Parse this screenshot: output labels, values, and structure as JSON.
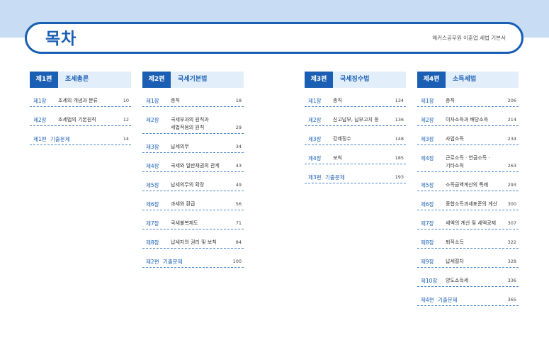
{
  "header": {
    "title": "목차",
    "subtitle": "해커스공무원 이훈업 세법 기본서"
  },
  "columns": [
    {
      "part_num": "제1편",
      "part_title": "조세총론",
      "entries": [
        {
          "num": "제1장",
          "title": "조세의 개념과 분류",
          "page": "10"
        },
        {
          "num": "제2장",
          "title": "조세법의 기본원칙",
          "page": "12"
        },
        {
          "num": "제1편",
          "title": "기출문제",
          "page": "14",
          "review": true
        }
      ]
    },
    {
      "part_num": "제2편",
      "part_title": "국세기본법",
      "entries": [
        {
          "num": "제1장",
          "title": "총칙",
          "page": "18"
        },
        {
          "num": "제2장",
          "title": "국세부과의 원칙과\n세법적용의 원칙",
          "page": "29"
        },
        {
          "num": "제3장",
          "title": "납세의무",
          "page": "34"
        },
        {
          "num": "제4장",
          "title": "국세와 일반채권의 관계",
          "page": "43"
        },
        {
          "num": "제5장",
          "title": "납세의무의 확장",
          "page": "49"
        },
        {
          "num": "제6장",
          "title": "과세와 환급",
          "page": "56"
        },
        {
          "num": "제7장",
          "title": "국세불복제도",
          "page": "71"
        },
        {
          "num": "제8장",
          "title": "납세자의 권리 및 보칙",
          "page": "84"
        },
        {
          "num": "제2편",
          "title": "기출문제",
          "page": "100",
          "review": true
        }
      ]
    },
    {
      "part_num": "제3편",
      "part_title": "국세징수법",
      "entries": [
        {
          "num": "제1장",
          "title": "총칙",
          "page": "134"
        },
        {
          "num": "제2장",
          "title": "신고납부, 납부고지 등",
          "page": "136"
        },
        {
          "num": "제3장",
          "title": "강제징수",
          "page": "148"
        },
        {
          "num": "제4장",
          "title": "보칙",
          "page": "185"
        },
        {
          "num": "제3편",
          "title": "기출문제",
          "page": "193",
          "review": true
        }
      ]
    },
    {
      "part_num": "제4편",
      "part_title": "소득세법",
      "entries": [
        {
          "num": "제1장",
          "title": "총칙",
          "page": "206"
        },
        {
          "num": "제2장",
          "title": "이자소득과 배당소득",
          "page": "214"
        },
        {
          "num": "제3장",
          "title": "사업소득",
          "page": "234"
        },
        {
          "num": "제4장",
          "title": "근로소득 · 연금소득 ·\n기타소득",
          "page": "263"
        },
        {
          "num": "제5장",
          "title": "소득금액계산의 특례",
          "page": "293"
        },
        {
          "num": "제6장",
          "title": "종합소득과세표준의 계산",
          "page": "300"
        },
        {
          "num": "제7장",
          "title": "세액의 계산 및 세액공제",
          "page": "307"
        },
        {
          "num": "제8장",
          "title": "퇴직소득",
          "page": "322"
        },
        {
          "num": "제9장",
          "title": "납세절차",
          "page": "328"
        },
        {
          "num": "제10장",
          "title": "양도소득세",
          "page": "336"
        },
        {
          "num": "제4편",
          "title": "기출문제",
          "page": "365",
          "review": true
        }
      ]
    }
  ]
}
